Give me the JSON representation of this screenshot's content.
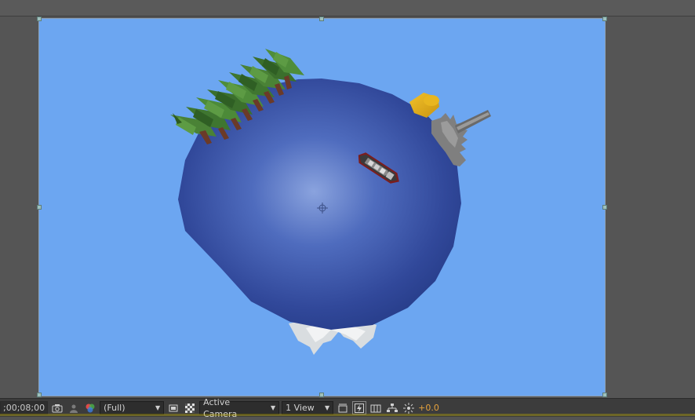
{
  "viewer": {
    "background": "#6ca6f1",
    "layers": [
      "planet",
      "pine-trees",
      "boat",
      "yellow-barrel",
      "gray-fence-pipe",
      "white-rocks",
      "anchor-point"
    ]
  },
  "statusbar": {
    "timecode": ";00;08;00",
    "resolution": "(Full)",
    "camera": "Active Camera",
    "views": "1 View",
    "exposure": "+0.0",
    "icons": [
      "camera-icon",
      "person-icon",
      "color-channels-icon",
      "region-of-interest-icon",
      "transparency-grid-icon",
      "toggle-mask-icon",
      "fast-preview-icon",
      "timeline-icon",
      "flowchart-icon",
      "reset-exposure-icon"
    ]
  }
}
